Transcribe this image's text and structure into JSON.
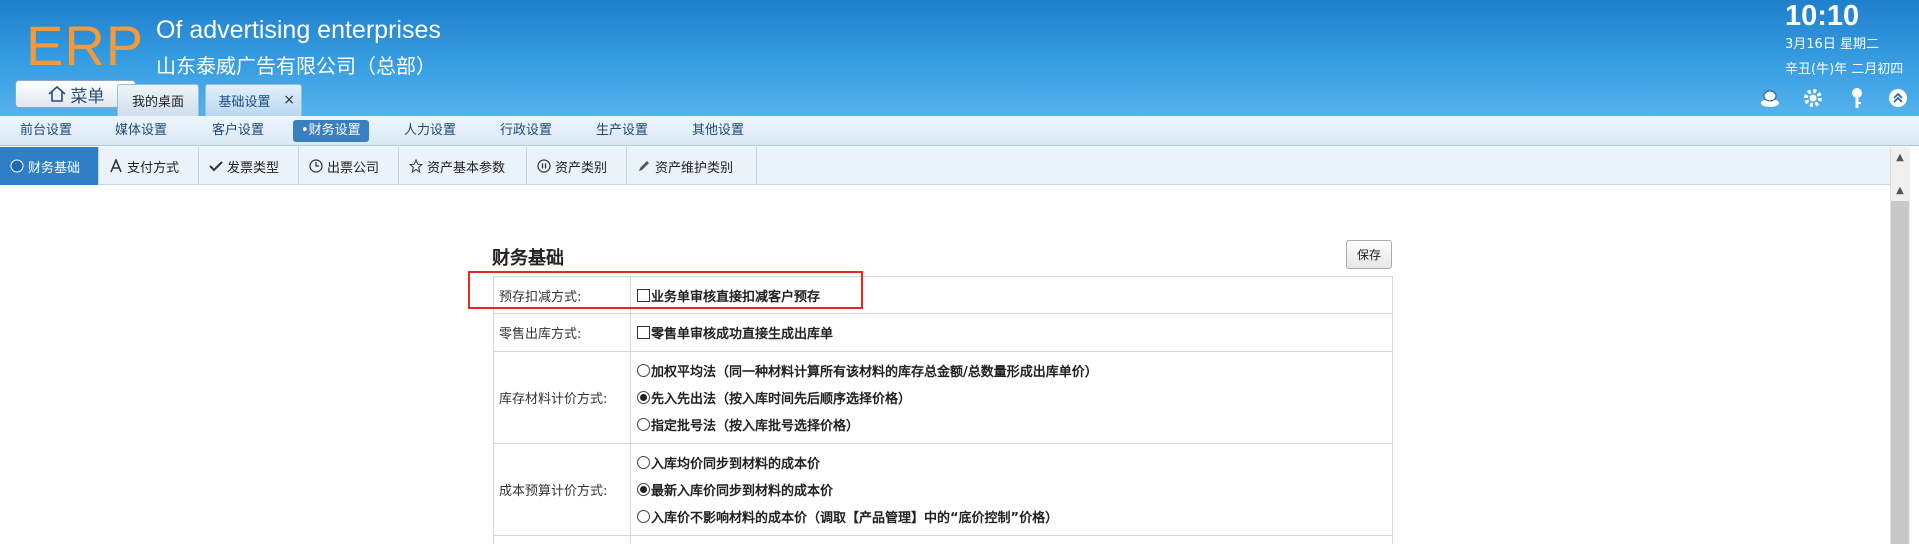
{
  "header": {
    "logo": "ERP",
    "company_en": "Of advertising enterprises",
    "company_cn": "山东泰威广告有限公司（总部）",
    "time": "10:10",
    "date": "3月16日 星期二",
    "lunar": "辛丑(牛)年 二月初四",
    "menu_label": "菜单"
  },
  "tabs": [
    {
      "label": "我的桌面"
    },
    {
      "label": "基础设置",
      "close": "×"
    }
  ],
  "topnav": [
    "前台设置",
    "媒体设置",
    "客户设置",
    "•财务设置",
    "人力设置",
    "行政设置",
    "生产设置",
    "其他设置"
  ],
  "subnav": [
    "财务基础",
    "支付方式",
    "发票类型",
    "出票公司",
    "资产基本参数",
    "资产类别",
    "资产维护类别"
  ],
  "section": {
    "title": "财务基础",
    "save": "保存"
  },
  "form": {
    "prestore_label": "预存扣减方式:",
    "prestore_opt": "业务单审核直接扣减客户预存",
    "retail_label": "零售出库方式:",
    "retail_opt": "零售单审核成功直接生成出库单",
    "stock_label": "库存材料计价方式:",
    "stock_opt1": "加权平均法（同一种材料计算所有该材料的库存总金额/总数量形成出库单价）",
    "stock_opt2": "先入先出法（按入库时间先后顺序选择价格）",
    "stock_opt3": "指定批号法（按入库批号选择价格）",
    "cost_label": "成本预算计价方式:",
    "cost_opt1": "入库均价同步到材料的成本价",
    "cost_opt2": "最新入库价同步到材料的成本价",
    "cost_opt3": "入库价不影响材料的成本价（调取【产品管理】中的“底价控制”价格）",
    "selected": {
      "stock": 2,
      "cost": 2
    }
  },
  "colors": {
    "header_top": "#1e7fcb",
    "logo": "#f39a3c",
    "active_nav": "#3a7fc0",
    "highlight": "#e8271f"
  }
}
